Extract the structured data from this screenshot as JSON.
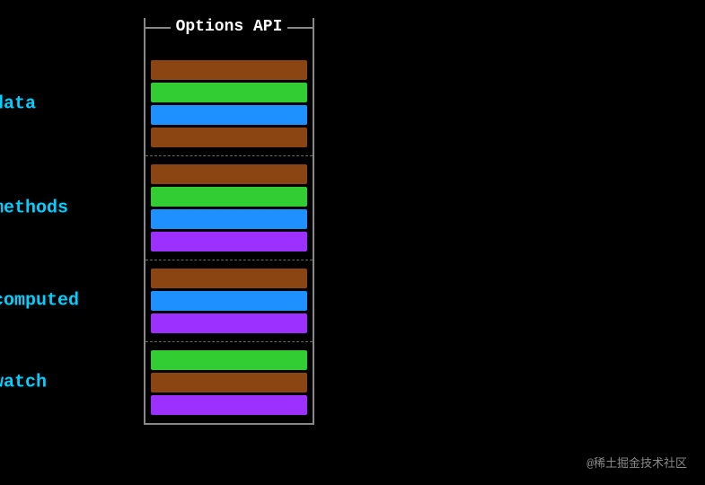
{
  "title": "Options API",
  "sections": [
    {
      "label": "data",
      "bars": [
        "brown",
        "green",
        "blue",
        "brown"
      ]
    },
    {
      "label": "methods",
      "bars": [
        "brown",
        "green",
        "blue",
        "purple"
      ]
    },
    {
      "label": "computed",
      "bars": [
        "brown",
        "blue",
        "purple"
      ]
    },
    {
      "label": "watch",
      "bars": [
        "green",
        "brown",
        "purple"
      ]
    }
  ],
  "watermark": "@稀土掘金技术社区"
}
